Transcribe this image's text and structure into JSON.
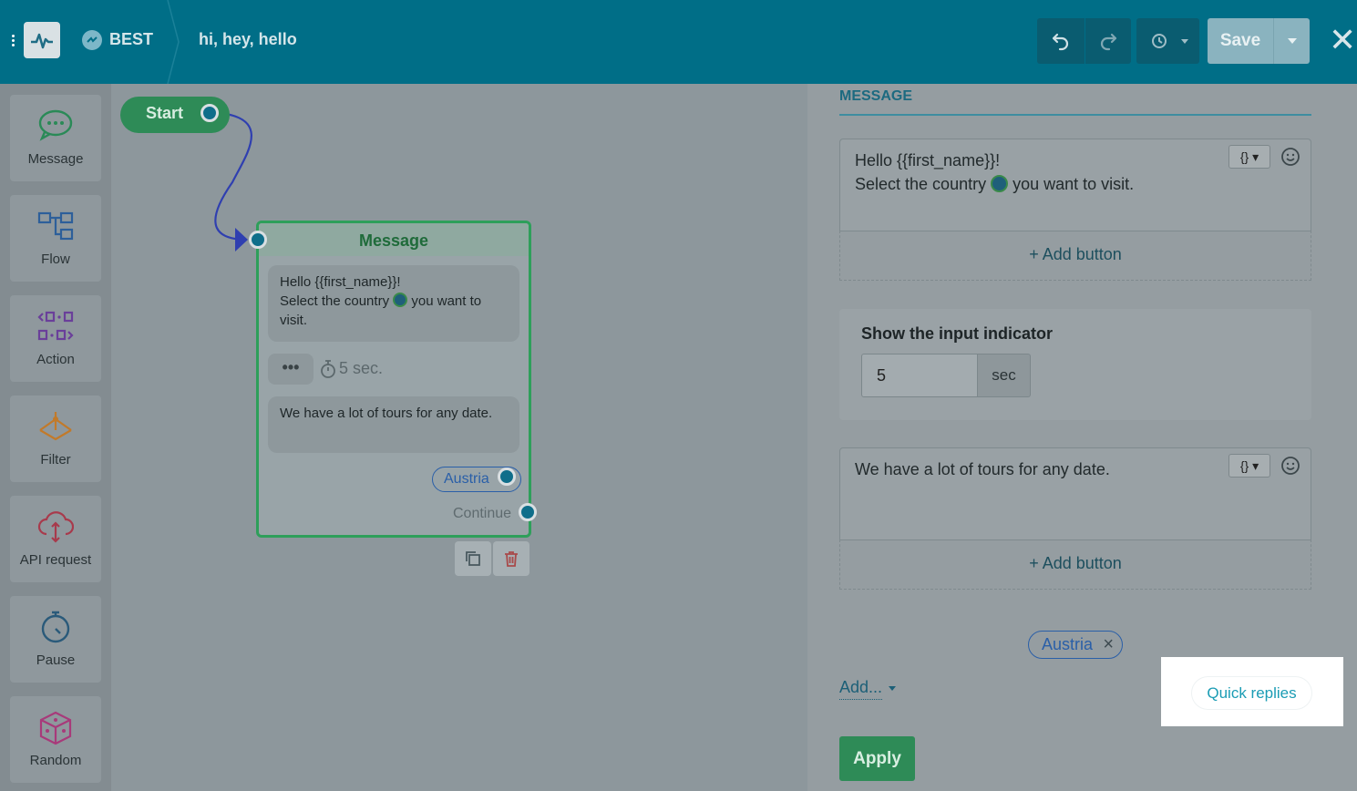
{
  "topbar": {
    "bot_name": "BEST",
    "flow_name": "hi, hey, hello",
    "save_label": "Save"
  },
  "sidebar": {
    "items": [
      {
        "label": "Message",
        "icon": "chat-bubble-icon"
      },
      {
        "label": "Flow",
        "icon": "flow-icon"
      },
      {
        "label": "Action",
        "icon": "action-icon"
      },
      {
        "label": "Filter",
        "icon": "filter-icon"
      },
      {
        "label": "API request",
        "icon": "cloud-icon"
      },
      {
        "label": "Pause",
        "icon": "stopwatch-icon"
      },
      {
        "label": "Random",
        "icon": "dice-icon"
      }
    ]
  },
  "canvas": {
    "start_label": "Start",
    "node": {
      "title": "Message",
      "msg1_line1": "Hello  {{first_name}}!",
      "msg1_line2a": "Select the country ",
      "msg1_line2b": " you want to",
      "msg1_line3": "visit.",
      "typing": "•••",
      "delay": "5 sec.",
      "msg2": "We have a lot of tours for any date.",
      "quick_reply": "Austria",
      "continue": "Continue"
    }
  },
  "panel": {
    "section_title": "MESSAGE",
    "message1_line1": "Hello  {{first_name}}!",
    "message1_line2a": "Select the country ",
    "message1_line2b": " you want to visit.",
    "add_button_label": "+ Add button",
    "var_button": "{}",
    "indicator_title": "Show the input indicator",
    "indicator_value": "5",
    "indicator_unit": "sec",
    "message2": "We have a lot of tours for any date.",
    "quick_reply_chip": "Austria",
    "add_menu": "Add...",
    "quick_replies_option": "Quick replies",
    "apply_label": "Apply"
  },
  "colors": {
    "topbar": "#006e87",
    "accent_green": "#2e8b57",
    "link_blue": "#2a5fa8",
    "quick_replies_text": "#1a9cb4"
  }
}
